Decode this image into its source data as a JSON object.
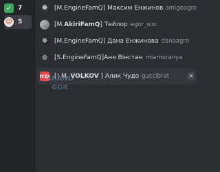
{
  "sidebar": {
    "items": [
      {
        "icon": "check-icon",
        "glyph": "✓",
        "count": "7"
      },
      {
        "icon": "faces-icon",
        "glyph": "☺",
        "count": "5"
      }
    ]
  },
  "rows": [
    {
      "name": "[M.EngineFamQ] Максим Енжинов",
      "username": "amigoagro"
    },
    {
      "name_prefix": "[M.",
      "name_bold": "AkiriFamQ",
      "name_suffix": "] Тейлор",
      "username": "egor_wxc"
    },
    {
      "name": "[M.EngineFamQ] Дана Енжинова",
      "username": "danaagro"
    },
    {
      "name": "[S.EngineFamQ]Аня Вінстан",
      "username": "miamoranya"
    },
    {
      "name_prefix": "[! M. ",
      "name_bold": "VOLKOV",
      "name_suffix": " ] Алик Чудо",
      "username": "guccibrat",
      "avatar_text": "ЧУДО",
      "close": "×"
    }
  ],
  "watermark": {
    "line1": "GRAND",
    "line2": "GGR"
  }
}
